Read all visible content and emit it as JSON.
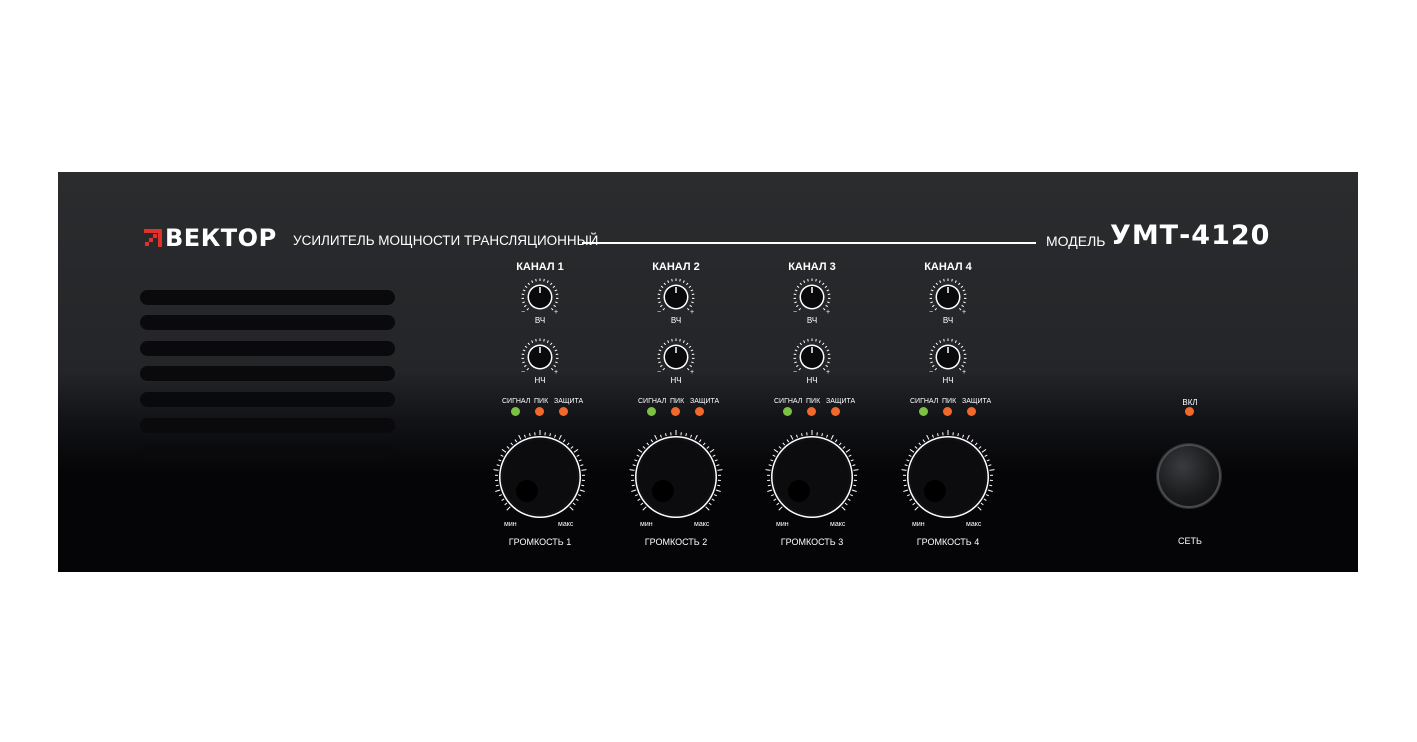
{
  "brand": {
    "name": "ВЕКТОР",
    "accent": "#e0312a"
  },
  "subtitle": "УСИЛИТЕЛЬ МОЩНОСТИ ТРАНСЛЯЦИОННЫЙ",
  "model": {
    "label": "МОДЕЛЬ",
    "name": "УМТ-4120"
  },
  "channels": [
    {
      "label": "КАНАЛ 1",
      "volume_label": "ГРОМКОСТЬ 1"
    },
    {
      "label": "КАНАЛ 2",
      "volume_label": "ГРОМКОСТЬ 2"
    },
    {
      "label": "КАНАЛ 3",
      "volume_label": "ГРОМКОСТЬ 3"
    },
    {
      "label": "КАНАЛ 4",
      "volume_label": "ГРОМКОСТЬ 4"
    }
  ],
  "tone": {
    "treble": "ВЧ",
    "bass": "НЧ",
    "minus": "−",
    "plus": "+"
  },
  "indicators": {
    "signal": "СИГНАЛ",
    "peak": "ПИК",
    "protect": "ЗАЩИТА"
  },
  "volume_scale": {
    "min": "мин",
    "max": "макс"
  },
  "power": {
    "indicator_label": "ВКЛ",
    "button_label": "СЕТЬ"
  },
  "colors": {
    "panel": "#232528",
    "led_green": "#7cc242",
    "led_orange": "#f26a2a",
    "text": "#ffffff"
  }
}
